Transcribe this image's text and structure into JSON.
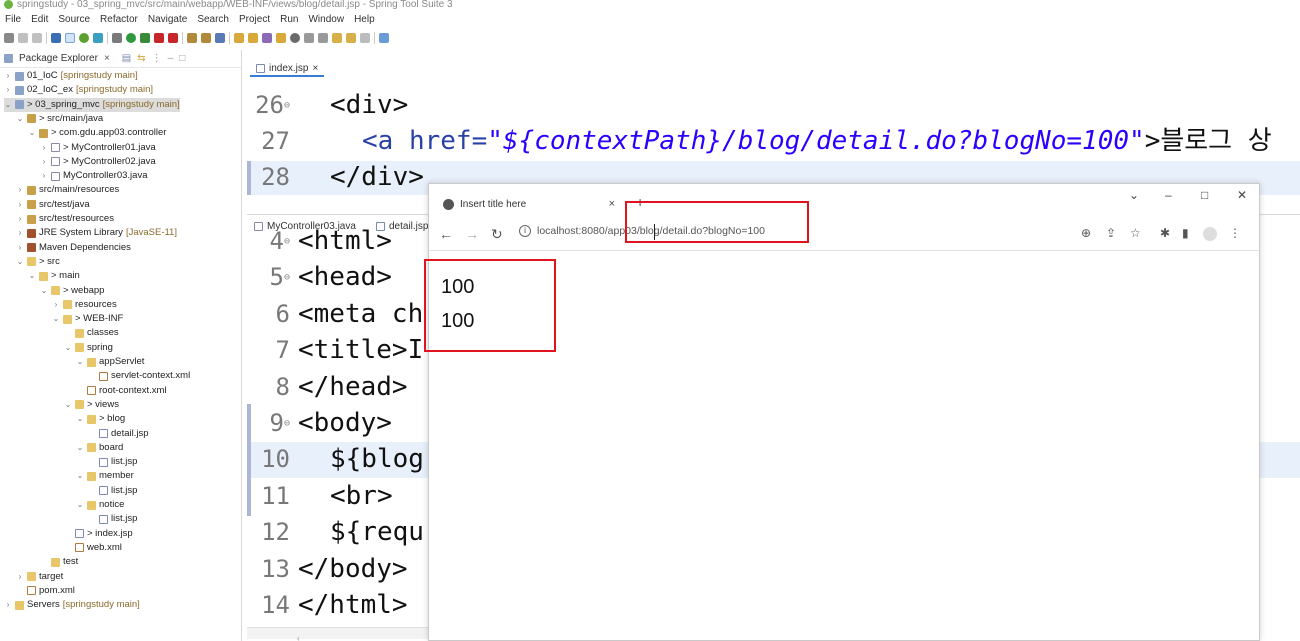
{
  "ide": {
    "title": "springstudy - 03_spring_mvc/src/main/webapp/WEB-INF/views/blog/detail.jsp - Spring Tool Suite 3",
    "menu": [
      "File",
      "Edit",
      "Source",
      "Refactor",
      "Navigate",
      "Search",
      "Project",
      "Run",
      "Window",
      "Help"
    ]
  },
  "package_explorer": {
    "title": "Package Explorer",
    "tree": [
      {
        "label": "01_IoC",
        "decor": "[springstudy main]",
        "icon": "project-icon"
      },
      {
        "label": "02_IoC_ex",
        "decor": "[springstudy main]",
        "icon": "project-icon"
      },
      {
        "label": "> 03_spring_mvc",
        "decor": "[springstudy main]",
        "icon": "project-icon"
      },
      {
        "label": "> src/main/java",
        "decor": "",
        "icon": "source-folder-icon"
      },
      {
        "label": "> com.gdu.app03.controller",
        "decor": "",
        "icon": "package-icon"
      },
      {
        "label": "> MyController01.java",
        "decor": "",
        "icon": "java-file-icon"
      },
      {
        "label": "> MyController02.java",
        "decor": "",
        "icon": "java-file-icon"
      },
      {
        "label": "MyController03.java",
        "decor": "",
        "icon": "java-file-icon"
      },
      {
        "label": "src/main/resources",
        "decor": "",
        "icon": "source-folder-icon"
      },
      {
        "label": "src/test/java",
        "decor": "",
        "icon": "source-folder-icon"
      },
      {
        "label": "src/test/resources",
        "decor": "",
        "icon": "source-folder-icon"
      },
      {
        "label": "JRE System Library",
        "decor": "[JavaSE-11]",
        "icon": "library-icon"
      },
      {
        "label": "Maven Dependencies",
        "decor": "",
        "icon": "library-icon"
      },
      {
        "label": "> src",
        "decor": "",
        "icon": "folder-icon"
      },
      {
        "label": "> main",
        "decor": "",
        "icon": "folder-icon"
      },
      {
        "label": "> webapp",
        "decor": "",
        "icon": "folder-icon"
      },
      {
        "label": "resources",
        "decor": "",
        "icon": "folder-icon"
      },
      {
        "label": "> WEB-INF",
        "decor": "",
        "icon": "folder-icon"
      },
      {
        "label": "classes",
        "decor": "",
        "icon": "folder-icon"
      },
      {
        "label": "spring",
        "decor": "",
        "icon": "folder-icon"
      },
      {
        "label": "appServlet",
        "decor": "",
        "icon": "folder-icon"
      },
      {
        "label": "servlet-context.xml",
        "decor": "",
        "icon": "xml-file-icon"
      },
      {
        "label": "root-context.xml",
        "decor": "",
        "icon": "xml-file-icon"
      },
      {
        "label": "> views",
        "decor": "",
        "icon": "folder-icon"
      },
      {
        "label": "> blog",
        "decor": "",
        "icon": "folder-icon"
      },
      {
        "label": "detail.jsp",
        "decor": "",
        "icon": "jsp-file-icon"
      },
      {
        "label": "board",
        "decor": "",
        "icon": "folder-icon"
      },
      {
        "label": "list.jsp",
        "decor": "",
        "icon": "jsp-file-icon"
      },
      {
        "label": "member",
        "decor": "",
        "icon": "folder-icon"
      },
      {
        "label": "list.jsp",
        "decor": "",
        "icon": "jsp-file-icon"
      },
      {
        "label": "notice",
        "decor": "",
        "icon": "folder-icon"
      },
      {
        "label": "list.jsp",
        "decor": "",
        "icon": "jsp-file-icon"
      },
      {
        "label": "> index.jsp",
        "decor": "",
        "icon": "jsp-file-icon"
      },
      {
        "label": "web.xml",
        "decor": "",
        "icon": "xml-file-icon"
      },
      {
        "label": "test",
        "decor": "",
        "icon": "folder-icon"
      },
      {
        "label": "target",
        "decor": "",
        "icon": "folder-icon"
      },
      {
        "label": "pom.xml",
        "decor": "",
        "icon": "xml-file-icon"
      },
      {
        "label": "Servers",
        "decor": "[springstudy main]",
        "icon": "folder-icon"
      }
    ]
  },
  "editor_top": {
    "tab": "index.jsp",
    "lines": [
      {
        "num": "26",
        "html_text": "<div>"
      },
      {
        "num": "27",
        "a_open": "<a href=",
        "href": "\"${contextPath}/blog/detail.do?blogNo=100\"",
        "tail": ">블로그 상"
      },
      {
        "num": "28",
        "html_text": "</div>"
      }
    ]
  },
  "editor_bottom": {
    "tabs": [
      "MyController03.java",
      "detail.jsp"
    ],
    "lines": [
      {
        "num": "4",
        "text": "<html>"
      },
      {
        "num": "5",
        "text": "<head>"
      },
      {
        "num": "6",
        "text": "<meta ch"
      },
      {
        "num": "7",
        "text": "<title>I"
      },
      {
        "num": "8",
        "text": "</head>"
      },
      {
        "num": "9",
        "text": "<body>"
      },
      {
        "num": "10",
        "text": "${blog"
      },
      {
        "num": "11",
        "text": "<br>"
      },
      {
        "num": "12",
        "text": "${requ"
      },
      {
        "num": "13",
        "text": "</body>"
      },
      {
        "num": "14",
        "text": "</html>"
      }
    ]
  },
  "browser": {
    "tab_title": "Insert title here",
    "url_host": "localhost:8080/app03/blog/detail.do?blogNo=100",
    "content": [
      "100",
      "100"
    ]
  }
}
